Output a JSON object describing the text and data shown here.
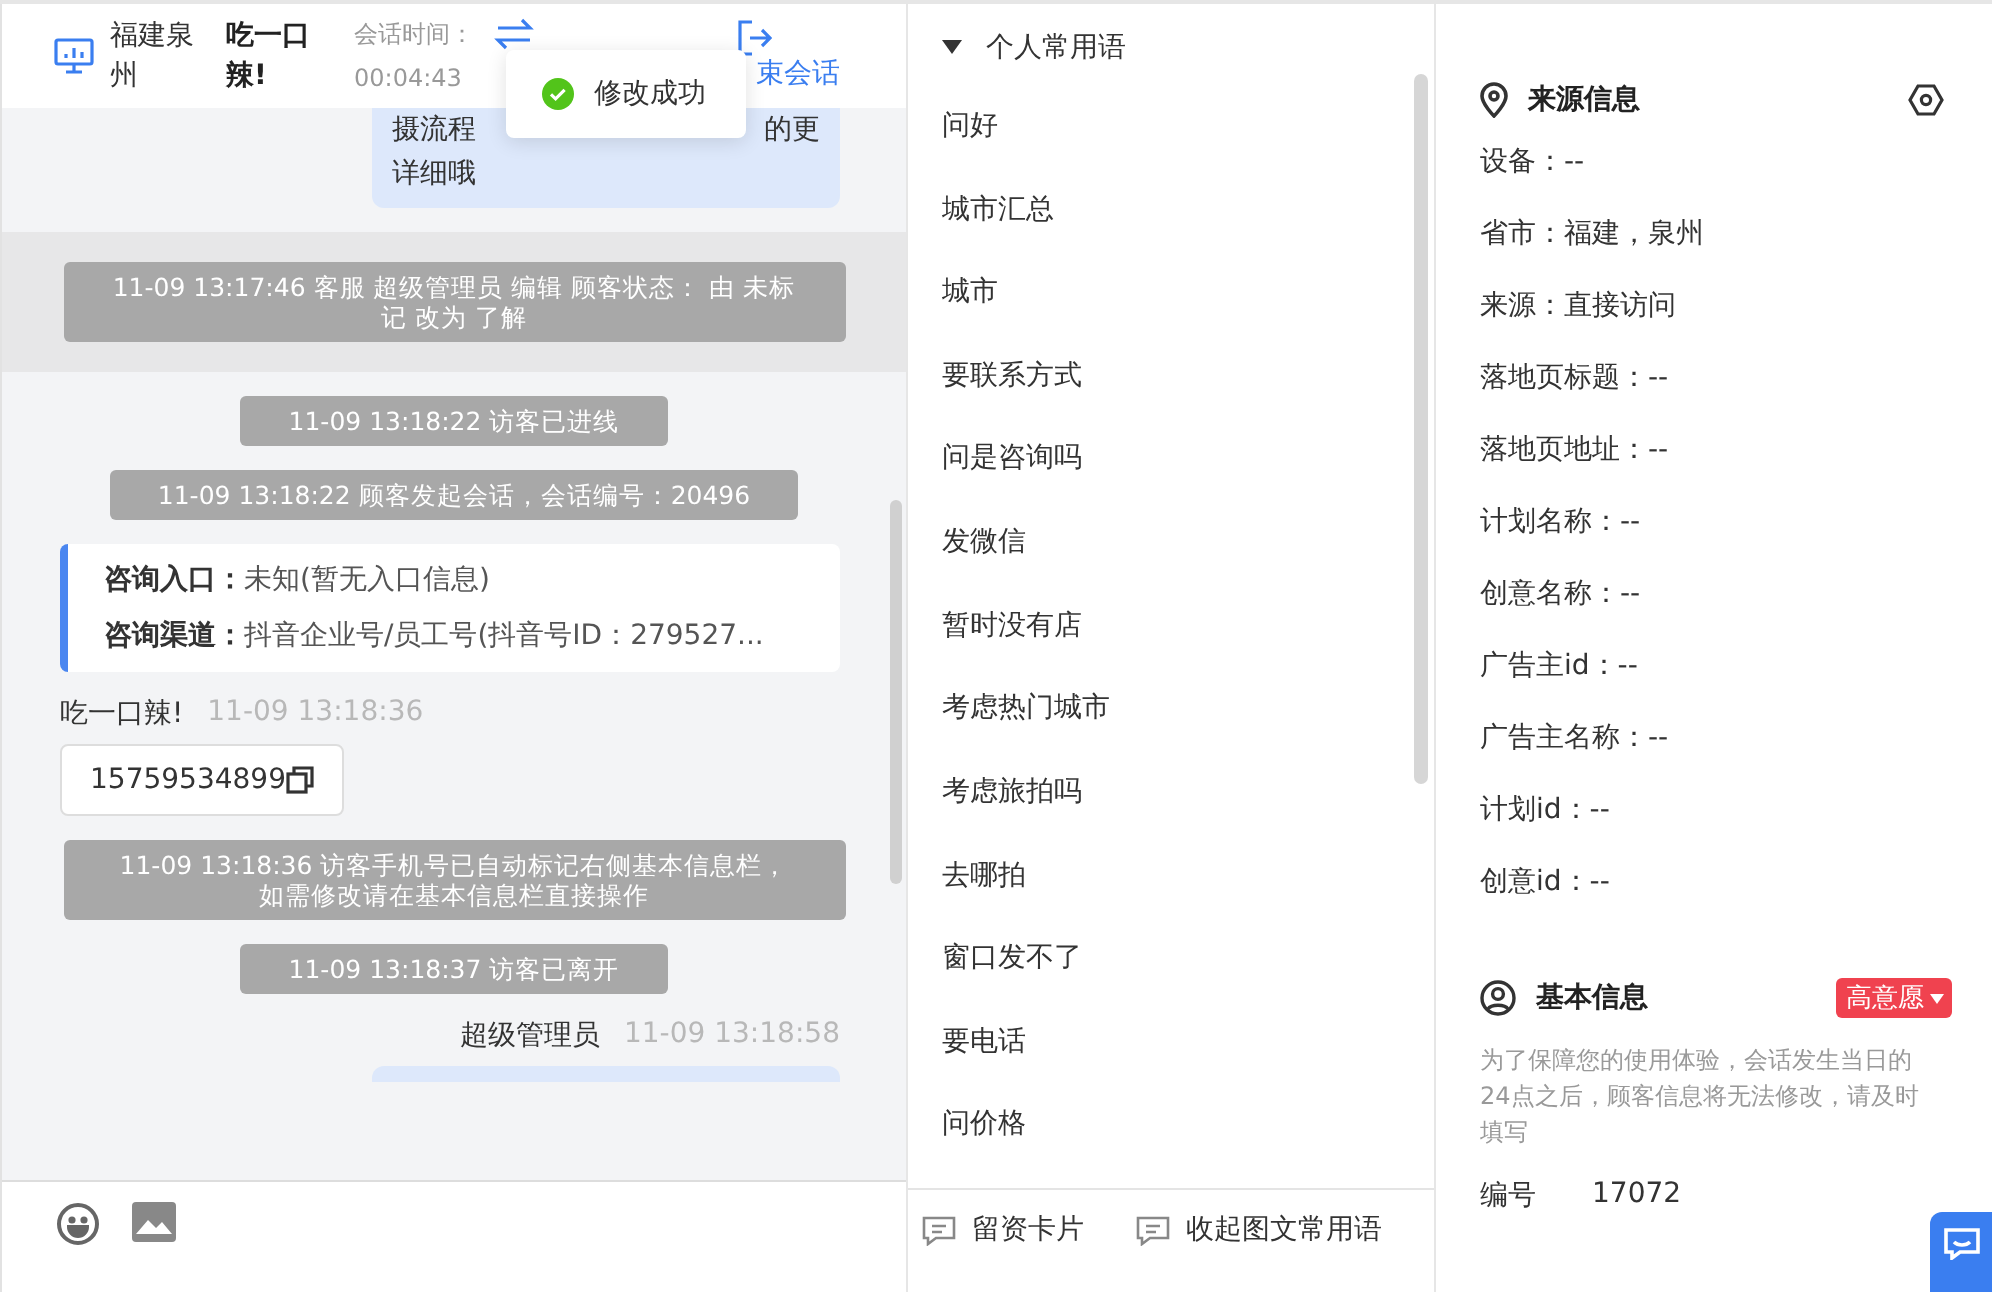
{
  "chat_header": {
    "location": "福建泉州",
    "visitor": "吃一口辣!",
    "duration_label": "会话时间：",
    "duration": "00:04:43",
    "end_label": "束会话"
  },
  "toast": {
    "text": "修改成功"
  },
  "messages": [
    {
      "kind": "agent_bubble_cut",
      "lines": [
        [
          "摄流程",
          "的更"
        ],
        [
          "详细哦"
        ]
      ]
    },
    {
      "kind": "system",
      "text": "11-09 13:17:46 客服 超级管理员 编辑 顾客状态： 由 未标记 改为 了解",
      "highlighted": true
    },
    {
      "kind": "system",
      "text": "11-09 13:18:22 访客已进线",
      "highlighted": false
    },
    {
      "kind": "system",
      "text": "11-09 13:18:22 顾客发起会话，会话编号：20496",
      "highlighted": false
    },
    {
      "kind": "info_card",
      "rows": [
        {
          "label": "咨询入口：",
          "value": "未知(暂无入口信息)"
        },
        {
          "label": "咨询渠道：",
          "value": "抖音企业号/员工号(抖音号ID：279527..."
        }
      ]
    },
    {
      "kind": "visitor",
      "name": "吃一口辣!",
      "time": "11-09 13:18:36",
      "text": "15759534899"
    },
    {
      "kind": "system",
      "text": "11-09 13:18:36 访客手机号已自动标记右侧基本信息栏，如需修改请在基本信息栏直接操作",
      "highlighted": false
    },
    {
      "kind": "system",
      "text": "11-09 13:18:37 访客已离开",
      "highlighted": false
    },
    {
      "kind": "agent",
      "name": "超级管理员",
      "time": "11-09 13:18:58"
    }
  ],
  "phrases": {
    "group": "个人常用语",
    "expanded": true,
    "items": [
      "问好",
      "城市汇总",
      "城市",
      "要联系方式",
      "问是咨询吗",
      "发微信",
      "暂时没有店",
      "考虑热门城市",
      "考虑旅拍吗",
      "去哪拍",
      "窗口发不了",
      "要电话",
      "问价格"
    ],
    "actions": [
      "留资卡片",
      "收起图文常用语"
    ]
  },
  "source_info": {
    "title": "来源信息",
    "fields": [
      "设备：--",
      "省市：福建，泉州",
      "来源：直接访问",
      "落地页标题：--",
      "落地页地址：--",
      "计划名称：--",
      "创意名称：--",
      "广告主id：--",
      "广告主名称：--",
      "计划id：--",
      "创意id：--"
    ]
  },
  "basic_info": {
    "title": "基本信息",
    "intent": "高意愿",
    "note": "为了保障您的使用体验，会话发生当日的24点之后，顾客信息将无法修改，请及时填写",
    "fields": [
      {
        "label": "编号",
        "value": "17072"
      }
    ]
  }
}
